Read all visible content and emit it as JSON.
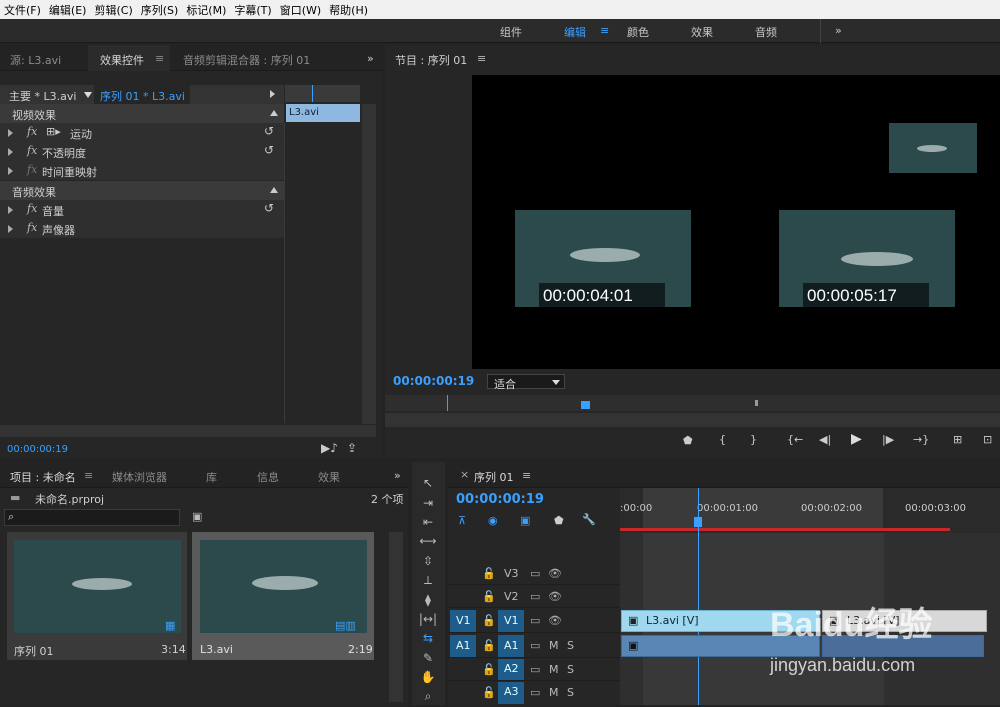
{
  "menu": [
    "文件(F)",
    "编辑(E)",
    "剪辑(C)",
    "序列(S)",
    "标记(M)",
    "字幕(T)",
    "窗口(W)",
    "帮助(H)"
  ],
  "workspaces": {
    "assembly": "组件",
    "editing": "编辑",
    "color": "颜色",
    "effects": "效果",
    "audio": "音频",
    "more": "»"
  },
  "source_panel": {
    "tabs": {
      "source": "源: L3.avi",
      "effect_controls": "效果控件",
      "audio_mixer": "音频剪辑混合器 : 序列 01"
    },
    "master_label": "主要 * L3.avi",
    "sequence_label": "序列 01 * L3.avi",
    "clip_label": "L3.avi",
    "video_effects": "视频效果",
    "audio_effects": "音频效果",
    "effects": {
      "motion": "运动",
      "opacity": "不透明度",
      "time_remap": "时间重映射",
      "volume": "音量",
      "panner": "声像器"
    },
    "fx_glyph": "fx",
    "timecode": "00:00:00:19"
  },
  "program": {
    "title": "节目 : 序列 01",
    "timecode": "00:00:00:19",
    "zoom": "适合",
    "overlay_tc1": "00:00:04:01",
    "overlay_tc2": "00:00:05:17"
  },
  "project": {
    "tabs": {
      "project": "项目 : 未命名",
      "media_browser": "媒体浏览器",
      "library": "库",
      "info": "信息",
      "effects": "效果"
    },
    "filename": "未命名.prproj",
    "item_count": "2 个项",
    "items": [
      {
        "name": "序列 01",
        "duration": "3:14"
      },
      {
        "name": "L3.avi",
        "duration": "2:19"
      }
    ]
  },
  "timeline": {
    "title": "序列 01",
    "timecode": "00:00:00:19",
    "ruler": [
      ":00:00",
      "00:00:01:00",
      "00:00:02:00",
      "00:00:03:00"
    ],
    "tracks": {
      "v3": "V3",
      "v2": "V2",
      "v1": "V1",
      "a1": "A1",
      "a2": "A2",
      "a3": "A3"
    },
    "src_v1": "V1",
    "src_a1": "A1",
    "mute": "M",
    "solo": "S",
    "clip1": "L3.avi [V]",
    "clip2": "L3.avi [V]"
  },
  "watermark": {
    "brand": "Baidu经验",
    "url": "jingyan.baidu.com"
  },
  "colors": {
    "accent": "#3aa0ff",
    "clip_video": "#9fd8ef",
    "clip_audio": "#5a86b5"
  }
}
